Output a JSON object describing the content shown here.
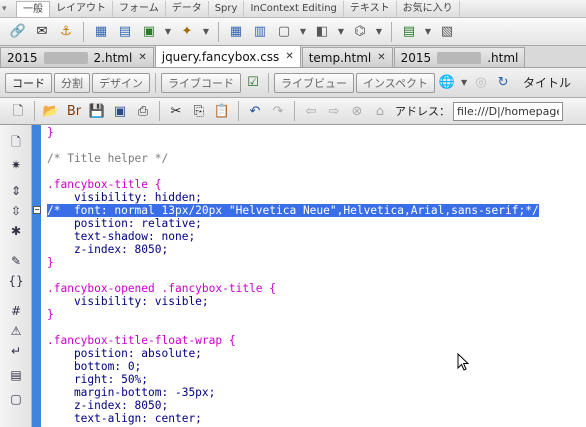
{
  "insert_bar": {
    "tabs": [
      "一般",
      "レイアウト",
      "フォーム",
      "データ",
      "Spry",
      "InContext Editing",
      "テキスト",
      "お気に入り"
    ]
  },
  "insert_icons": [
    "hyperlink-icon",
    "email-link-icon",
    "anchor-icon",
    "table-icon",
    "div-icon",
    "image-icon",
    "media-icon",
    "date-icon",
    "server-include-icon",
    "comment-icon",
    "head-icon",
    "script-icon",
    "templates-icon",
    "tag-chooser-icon"
  ],
  "document_tabs": [
    {
      "label": "2015…2.html",
      "prefix": "2015",
      "suffix": "2.html",
      "blurred": true,
      "active": false
    },
    {
      "label": "jquery.fancybox.css",
      "prefix": "jquery.fancybox.css",
      "suffix": "",
      "blurred": false,
      "active": true
    },
    {
      "label": "temp.html",
      "prefix": "temp.html",
      "suffix": "",
      "blurred": false,
      "active": false
    },
    {
      "label": "2015….html",
      "prefix": "2015",
      "suffix": ".html",
      "blurred": true,
      "active": false
    }
  ],
  "document_toolbar": {
    "code": "コード",
    "split": "分割",
    "design": "デザイン",
    "live_code": "ライブコード",
    "live_view": "ライブビュー",
    "inspect": "インスペクト",
    "title_label": "タイトル"
  },
  "standard_toolbar": {
    "address_label": "アドレス：",
    "address_value": "file:///D|/homepage"
  },
  "code_lines": [
    "}",
    "",
    "/* Title helper */",
    "",
    ".fancybox-title {",
    "    visibility: hidden;",
    "/*  font: normal 13px/20px \"Helvetica Neue\",Helvetica,Arial,sans-serif;*/",
    "    position: relative;",
    "    text-shadow: none;",
    "    z-index: 8050;",
    "}",
    "",
    ".fancybox-opened .fancybox-title {",
    "    visibility: visible;",
    "}",
    "",
    ".fancybox-title-float-wrap {",
    "    position: absolute;",
    "    bottom: 0;",
    "    right: 50%;",
    "    margin-bottom: -35px;",
    "    z-index: 8050;",
    "    text-align: center;"
  ],
  "colors": {
    "selection": "#3a6ee8",
    "gutter_strip": "#3f84dd",
    "selector": "#cc00cc",
    "property": "#000080",
    "comment": "#7a7a7a"
  }
}
